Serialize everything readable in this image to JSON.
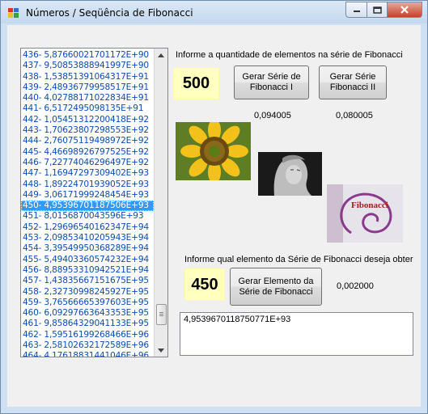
{
  "window": {
    "title": "Números / Seqüência de Fibonacci"
  },
  "list": {
    "items": [
      "436- 5,87660021701172E+90",
      "437- 9,50853888941997E+90",
      "438- 1,53851391064317E+91",
      "439- 2,48936779958517E+91",
      "440- 4,02788171022834E+91",
      "441- 6,5172495098135E+91",
      "442- 1,05451312200418E+92",
      "443- 1,70623807298553E+92",
      "444- 2,76075119498972E+92",
      "445- 4,46698926797525E+92",
      "446- 7,22774046296497E+92",
      "447- 1,16947297309402E+93",
      "448- 1,89224701939052E+93",
      "449- 3,06171999248454E+93",
      "450- 4,95396701187506E+93",
      "451- 8,0156870043596E+93",
      "452- 1,29696540162347E+94",
      "453- 2,09853410205943E+94",
      "454- 3,39549950368289E+94",
      "455- 5,49403360574232E+94",
      "456- 8,88953310942521E+94",
      "457- 1,43835667151675E+95",
      "458- 2,32730998245927E+95",
      "459- 3,76566665397603E+95",
      "460- 6,09297663643353E+95",
      "461- 9,85864329041133E+95",
      "462- 1,59516199268466E+96",
      "463- 2,58102632172589E+96",
      "464- 4,17618831441046E+96"
    ],
    "selected_index": 14
  },
  "series": {
    "prompt": "Informe a quantidade de elementos na série de Fibonacci",
    "quantity": "500",
    "button1_label": "Gerar Série de Fibonacci I",
    "button2_label": "Gerar Série Fibonacci II",
    "time1": "0,094005",
    "time2": "0,080005"
  },
  "element": {
    "prompt": "Informe qual elemento da Série de Fibonacci deseja obter",
    "index": "450",
    "button_label": "Gerar Elemento da Série de Fibonacci",
    "time": "0,002000",
    "result": "4,9539670118750771E+93"
  },
  "images": {
    "logo_text": "Fibonacci"
  }
}
